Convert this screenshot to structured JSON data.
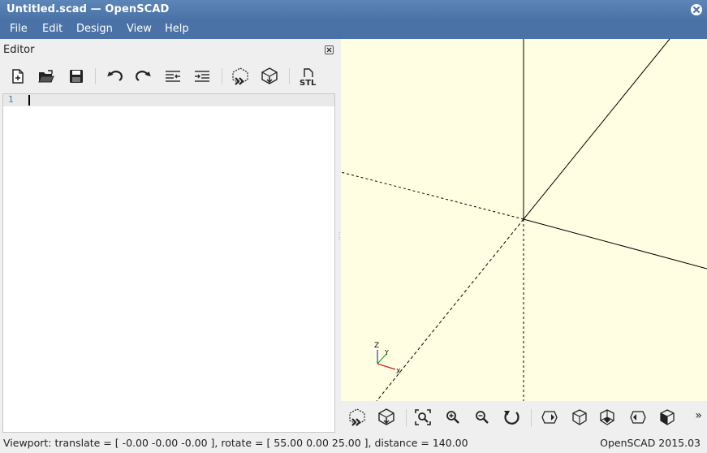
{
  "window": {
    "title": "Untitled.scad — OpenSCAD"
  },
  "menu": {
    "items": [
      {
        "label": "File"
      },
      {
        "label": "Edit"
      },
      {
        "label": "Design"
      },
      {
        "label": "View"
      },
      {
        "label": "Help"
      }
    ]
  },
  "editor": {
    "dock_title": "Editor",
    "line_number": "1",
    "toolbar": [
      {
        "name": "new-file-icon"
      },
      {
        "name": "open-file-icon"
      },
      {
        "name": "save-icon"
      },
      {
        "name": "undo-icon"
      },
      {
        "name": "redo-icon"
      },
      {
        "name": "unindent-icon"
      },
      {
        "name": "indent-icon"
      },
      {
        "name": "preview-icon"
      },
      {
        "name": "render-icon"
      },
      {
        "name": "export-stl-icon",
        "label": "STL"
      }
    ]
  },
  "viewport": {
    "axes_labels": {
      "z": "Z",
      "y": "Y",
      "x": "X"
    },
    "colors": {
      "background": "#fffee2",
      "x_axis": "#d02020",
      "y_axis": "#20a020",
      "z_axis": "#2040d0"
    },
    "toolbar": [
      {
        "name": "preview-icon"
      },
      {
        "name": "render-icon"
      },
      {
        "name": "view-all-icon"
      },
      {
        "name": "zoom-in-icon"
      },
      {
        "name": "zoom-out-icon"
      },
      {
        "name": "reset-view-icon"
      },
      {
        "name": "view-right-icon"
      },
      {
        "name": "view-top-icon"
      },
      {
        "name": "view-bottom-icon"
      },
      {
        "name": "view-left-icon"
      },
      {
        "name": "view-front-icon"
      }
    ],
    "more_label": "»"
  },
  "status": {
    "viewport": "Viewport: translate = [ -0.00 -0.00 -0.00 ], rotate = [ 55.00 0.00 25.00 ], distance = 140.00",
    "version": "OpenSCAD 2015.03"
  }
}
